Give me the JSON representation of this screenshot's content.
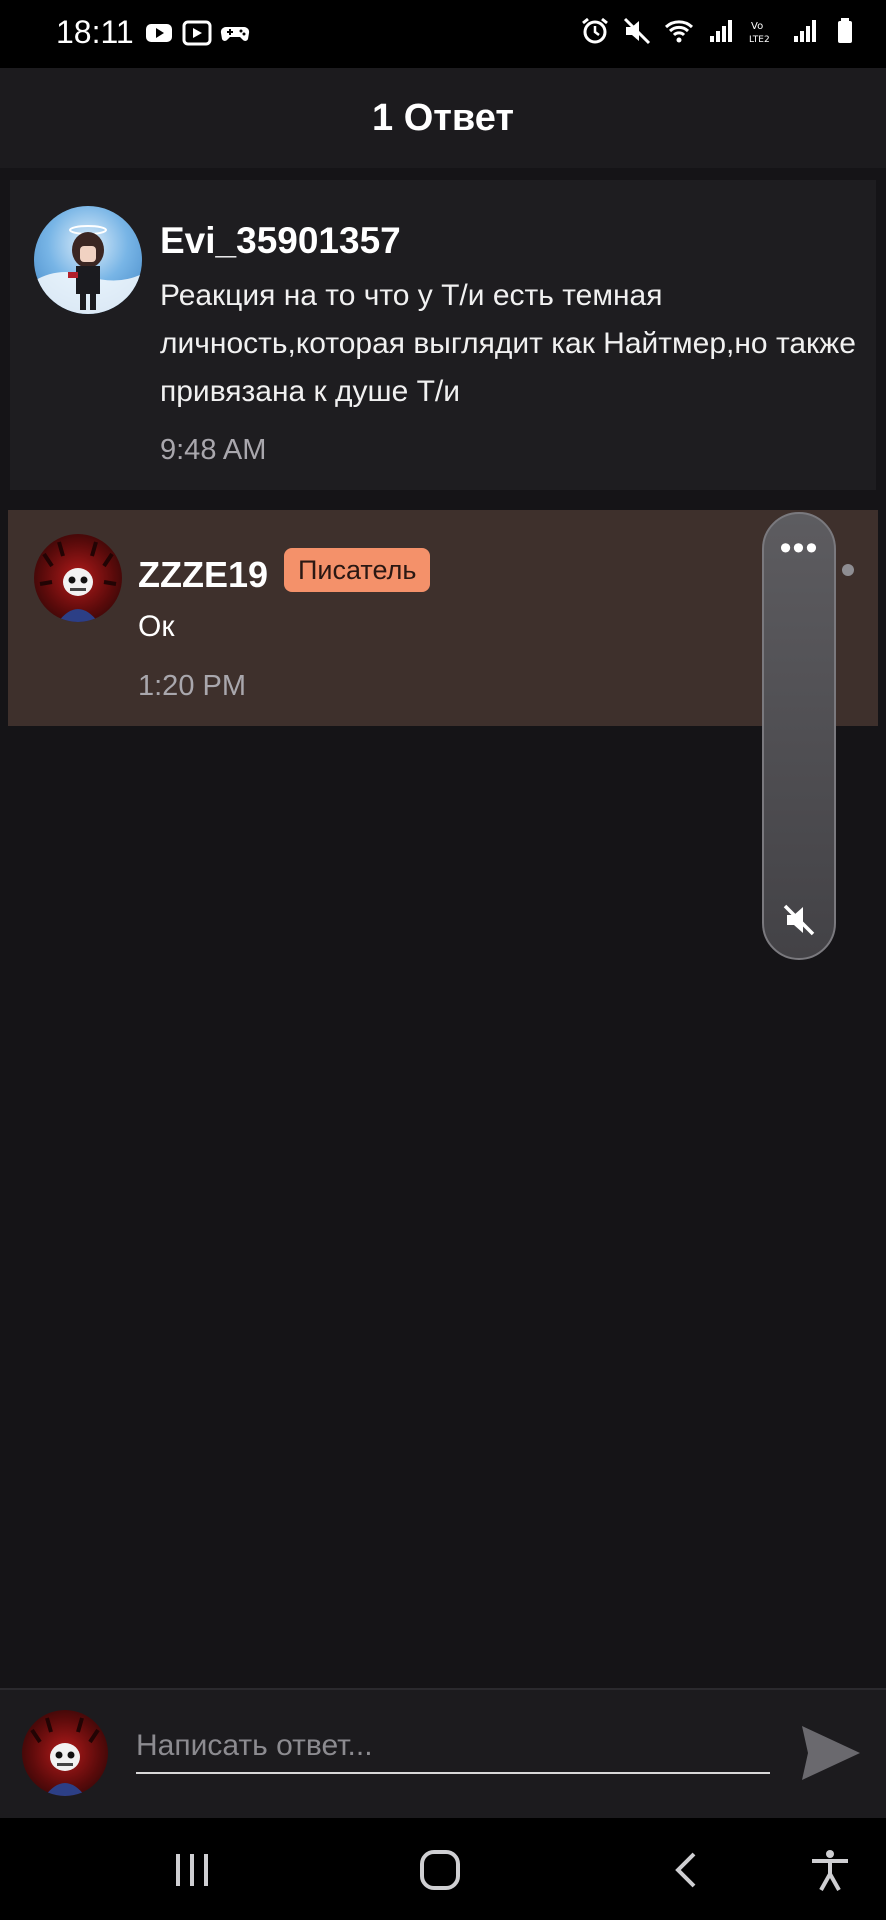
{
  "status_bar": {
    "time": "18:11",
    "left_icons": [
      "youtube-icon",
      "video-icon",
      "gamepad-icon"
    ],
    "right_icons": [
      "alarm-icon",
      "mute-icon",
      "wifi-icon",
      "signal-icon",
      "volte-icon",
      "signal-icon",
      "battery-icon"
    ]
  },
  "header": {
    "title": "1 Ответ"
  },
  "comment": {
    "author": "Evi_35901357",
    "text": "Реакция на то что у Т/и есть темная личность,которая выглядит как Найтмер,но также привязана к душе Т/и",
    "time": "9:48 AM"
  },
  "reply": {
    "author": "ZZZE19",
    "badge": "Писатель",
    "text": "Ок",
    "time": "1:20 PM"
  },
  "side_panel": {
    "icons": [
      "more-icon",
      "volume-mute-icon"
    ]
  },
  "composer": {
    "placeholder": "Написать ответ..."
  },
  "nav_bar": {
    "icons": [
      "recents-icon",
      "home-icon",
      "back-icon",
      "accessibility-icon"
    ]
  },
  "colors": {
    "background": "#151417",
    "header": "#1c1b1e",
    "reply_highlight": "#3e302c",
    "badge": "#f4916a"
  }
}
